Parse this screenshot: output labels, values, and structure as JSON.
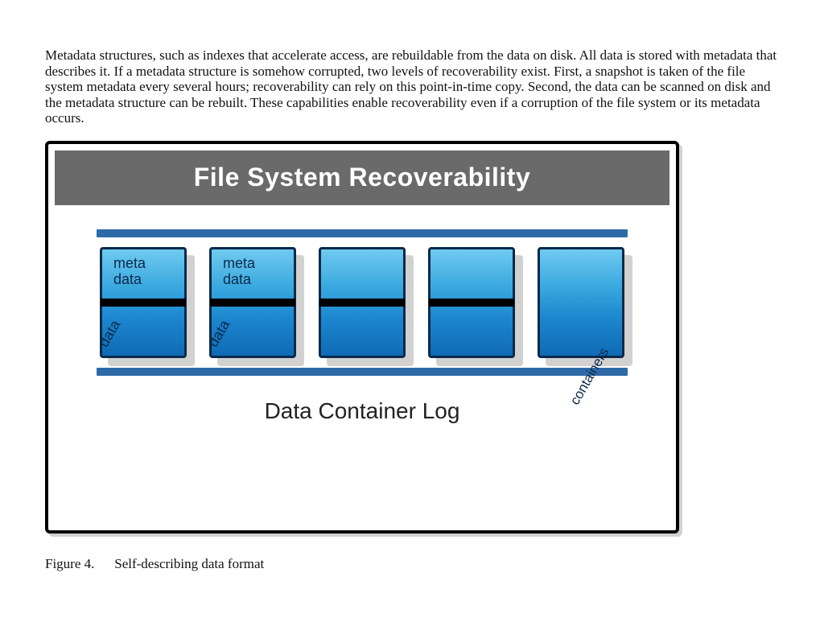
{
  "paragraph": "Metadata structures, such as indexes that accelerate access, are rebuildable from the data on disk. All data is stored with metadata that describes it. If a metadata structure is somehow corrupted, two levels of recoverability exist. First, a snapshot is taken of the file system metadata every several hours; recoverability can rely on this point-in-time copy. Second, the data can be scanned on disk and the metadata structure can be rebuilt. These capabilities enable recoverability even if a corruption of the file system or its metadata occurs.",
  "figure": {
    "title": "File System Recoverability",
    "log_label": "Data Container Log",
    "caption_number": "Figure 4.",
    "caption_text": "Self-describing data format",
    "box_labels": {
      "meta_top": "meta",
      "meta_bottom": "data",
      "data": "data",
      "containers": "containers"
    },
    "boxes": [
      {
        "show_meta": true,
        "show_data": true,
        "show_mid": true,
        "show_containers": false
      },
      {
        "show_meta": true,
        "show_data": true,
        "show_mid": true,
        "show_containers": false
      },
      {
        "show_meta": false,
        "show_data": false,
        "show_mid": true,
        "show_containers": false
      },
      {
        "show_meta": false,
        "show_data": false,
        "show_mid": true,
        "show_containers": false
      },
      {
        "show_meta": false,
        "show_data": false,
        "show_mid": false,
        "show_containers": true
      }
    ]
  }
}
